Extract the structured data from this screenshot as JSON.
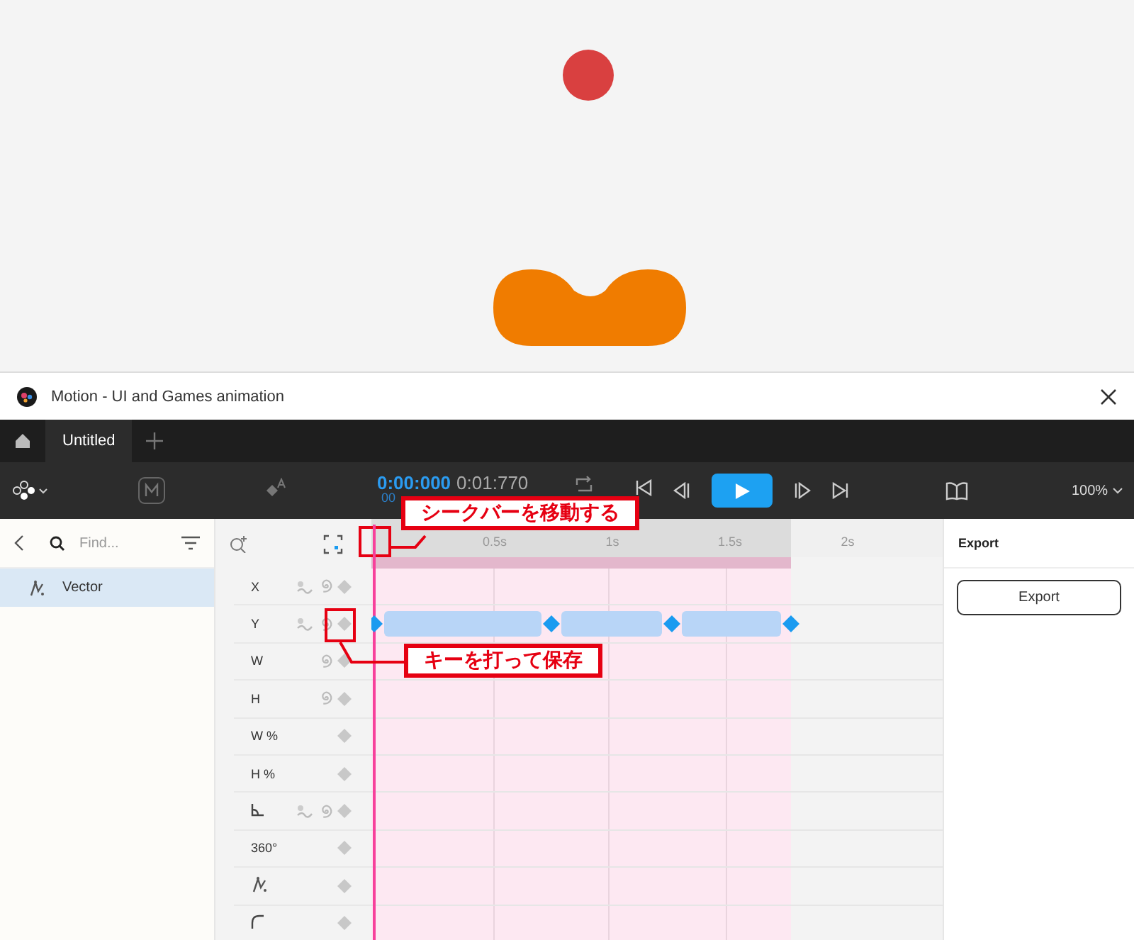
{
  "window": {
    "title": "Motion - UI and Games animation"
  },
  "tabs": [
    {
      "label": "Untitled",
      "selected": true
    }
  ],
  "toolbar": {
    "time_current": "0:00:000",
    "time_total": "0:01:770",
    "time_sub": "00",
    "zoom": "100%",
    "playing": false
  },
  "layers": {
    "placeholder": "Find...",
    "items": [
      {
        "name": "Vector",
        "selected": true
      }
    ]
  },
  "timeline": {
    "ticks": [
      "0.5s",
      "1s",
      "1.5s",
      "2s"
    ],
    "playhead": {
      "level": 0
    },
    "rows": [
      {
        "kind": "text",
        "label": "X",
        "easing": true,
        "spiral": true
      },
      {
        "kind": "text",
        "label": "Y",
        "easing": true,
        "spiral": true,
        "keyframes": [
          {
            "level": 0
          },
          {
            "level": 0.31
          },
          {
            "level": 0.52
          },
          {
            "level": 0.73
          }
        ]
      },
      {
        "kind": "text",
        "label": "W",
        "easing": false,
        "spiral": true
      },
      {
        "kind": "text",
        "label": "H",
        "easing": false,
        "spiral": true
      },
      {
        "kind": "text",
        "label": "W %",
        "easing": false,
        "spiral": false
      },
      {
        "kind": "text",
        "label": "H %",
        "easing": false,
        "spiral": false
      },
      {
        "kind": "angle",
        "easing": true,
        "spiral": true
      },
      {
        "kind": "text",
        "label": "360°",
        "easing": false,
        "spiral": false
      },
      {
        "kind": "path",
        "easing": false,
        "spiral": false
      },
      {
        "kind": "corner",
        "easing": false,
        "spiral": false
      }
    ]
  },
  "export": {
    "title": "Export",
    "button": "Export"
  },
  "callouts": [
    {
      "text": "シークバーを移動する"
    },
    {
      "text": "キーを打って保存"
    }
  ]
}
